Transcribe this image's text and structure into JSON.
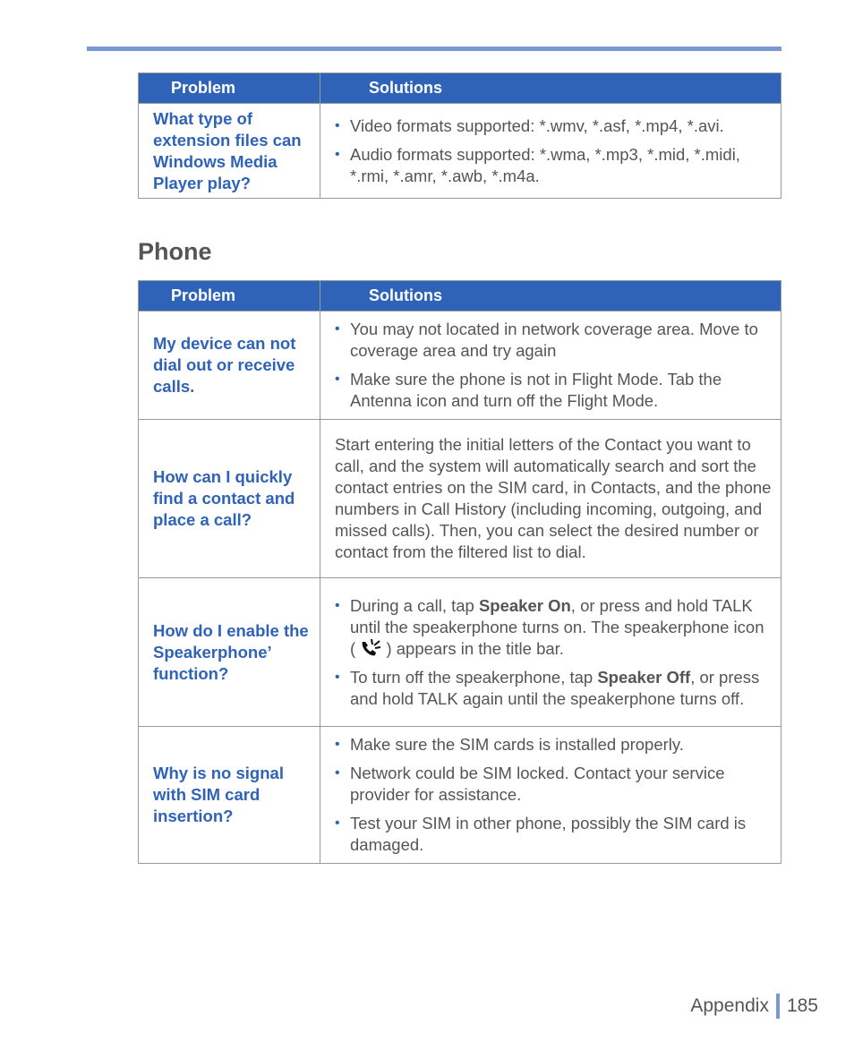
{
  "media_table": {
    "headers": {
      "problem": "Problem",
      "solutions": "Solutions"
    },
    "rows": [
      {
        "problem": "What type of extension files can Windows Media Player play?",
        "bullets": [
          "Video formats supported: *.wmv, *.asf, *.mp4, *.avi.",
          "Audio formats supported: *.wma, *.mp3, *.mid, *.midi, *.rmi, *.amr, *.awb, *.m4a."
        ]
      }
    ]
  },
  "section": {
    "title": "Phone"
  },
  "phone_table": {
    "headers": {
      "problem": "Problem",
      "solutions": "Solutions"
    },
    "rows": [
      {
        "problem": "My device can not dial out or receive calls.",
        "bullets": [
          "You may not located in network coverage area. Move to coverage area and try again",
          "Make sure the phone is not in Flight Mode. Tab the Antenna icon and turn off the Flight Mode."
        ]
      },
      {
        "problem": "How can I quickly find a contact and place a call?",
        "paragraph": "Start entering the initial letters of the Contact you want to call, and the system will automatically search and sort the contact entries on the SIM card, in Contacts, and the phone numbers in Call History (including incoming, outgoing, and missed calls). Then, you can select the desired number or contact from the filtered list to dial."
      },
      {
        "problem": "How do I enable the Speakerphone’ function?",
        "bullet1": {
          "pre": "During a call, tap ",
          "bold": "Speaker On",
          "mid": ", or press and hold TALK until the speakerphone turns on. The speakerphone icon ( ",
          "icon": "speakerphone-icon",
          "post": " ) appears in the title bar."
        },
        "bullet2": {
          "pre": "To turn off the speakerphone, tap ",
          "bold": "Speaker Off",
          "post": ", or press and hold TALK again until the speakerphone turns off."
        }
      },
      {
        "problem": "Why is no signal with SIM card insertion?",
        "bullets": [
          "Make sure the SIM cards is installed properly.",
          "Network could be SIM locked. Contact your service provider for assistance.",
          "Test your SIM in other phone, possibly the SIM card is damaged."
        ]
      }
    ]
  },
  "bullet_glyph": "•",
  "footer": {
    "section": "Appendix",
    "page": "185"
  },
  "colors": {
    "accent_blue": "#2f63b8",
    "rule_blue": "#7b97d6",
    "text_gray": "#555555"
  }
}
